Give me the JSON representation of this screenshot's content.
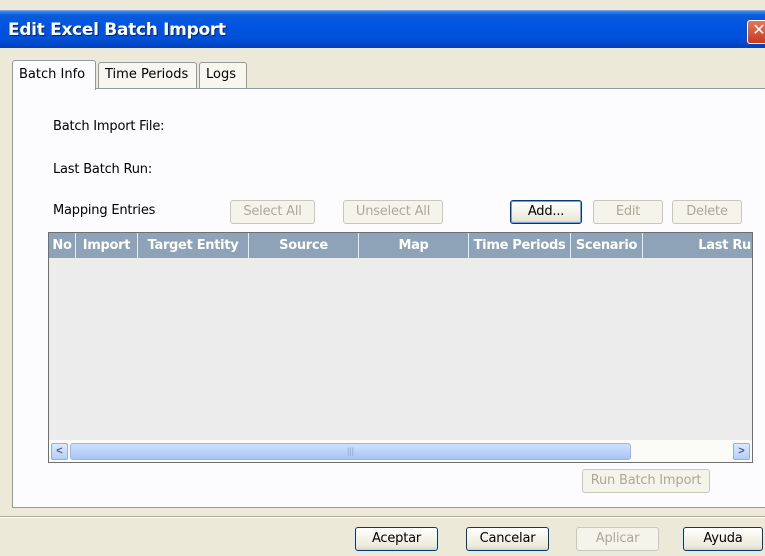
{
  "window": {
    "title": "Edit Excel Batch Import",
    "close_glyph": "✕"
  },
  "tabs": [
    {
      "label": "Batch Info",
      "active": true
    },
    {
      "label": "Time Periods",
      "active": false
    },
    {
      "label": "Logs",
      "active": false
    }
  ],
  "batch_info": {
    "batch_import_file_label": "Batch Import File:",
    "last_batch_run_label": "Last Batch Run:",
    "mapping_entries_label": "Mapping Entries"
  },
  "mapping_buttons": {
    "select_all": "Select All",
    "unselect_all": "Unselect All",
    "add": "Add...",
    "edit": "Edit",
    "delete": "Delete"
  },
  "table": {
    "columns": [
      "No",
      "Import",
      "Target Entity",
      "Source",
      "Map",
      "Time Periods",
      "Scenario",
      "Last Ru"
    ],
    "rows": []
  },
  "scrollbar": {
    "left_arrow": "<",
    "right_arrow": ">",
    "grip": "|||"
  },
  "run_batch_import": "Run Batch Import",
  "footer_buttons": {
    "ok": "Aceptar",
    "cancel": "Cancelar",
    "apply": "Aplicar",
    "help": "Ayuda"
  },
  "colors": {
    "titlebar": "#0054e3",
    "header_bg": "#8ea3b8",
    "dialog_bg": "#ece9d8"
  }
}
